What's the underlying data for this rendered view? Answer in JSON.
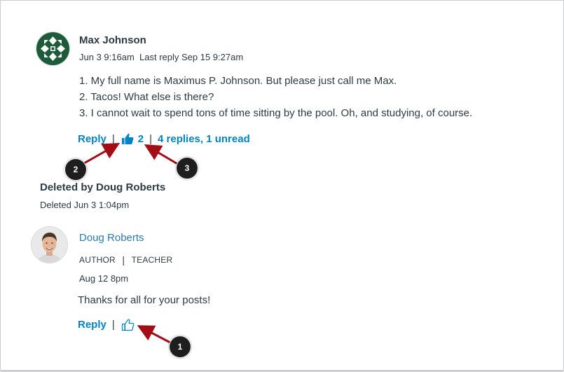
{
  "entry": {
    "author": "Max Johnson",
    "posted": "Jun 3 9:16am",
    "last_reply": "Last reply Sep 15 9:27am",
    "lines": [
      "1. My full name is Maximus P. Johnson. But please just call me Max.",
      "2. Tacos! What else is there?",
      "3. I cannot wait to spend tons of time sitting by the pool. Oh, and studying, of course."
    ],
    "reply_label": "Reply",
    "like_count": "2",
    "replies_label": "4 replies, 1 unread"
  },
  "deleted": {
    "title": "Deleted by Doug Roberts",
    "date": "Deleted Jun 3 1:04pm"
  },
  "reply": {
    "author": "Doug Roberts",
    "role_1": "AUTHOR",
    "role_2": "TEACHER",
    "date": "Aug 12 8pm",
    "message": "Thanks for all for your posts!",
    "reply_label": "Reply"
  },
  "callouts": {
    "one": "1",
    "two": "2",
    "three": "3"
  },
  "colors": {
    "link": "#0084c4",
    "name_link": "#2e79ad",
    "text": "#2d3b45",
    "arrow": "#a30d16",
    "avatar_green": "#1d5b3b"
  },
  "icons": [
    "thumbs-up-filled-icon",
    "thumbs-up-outline-icon",
    "geometric-avatar",
    "person-avatar"
  ]
}
